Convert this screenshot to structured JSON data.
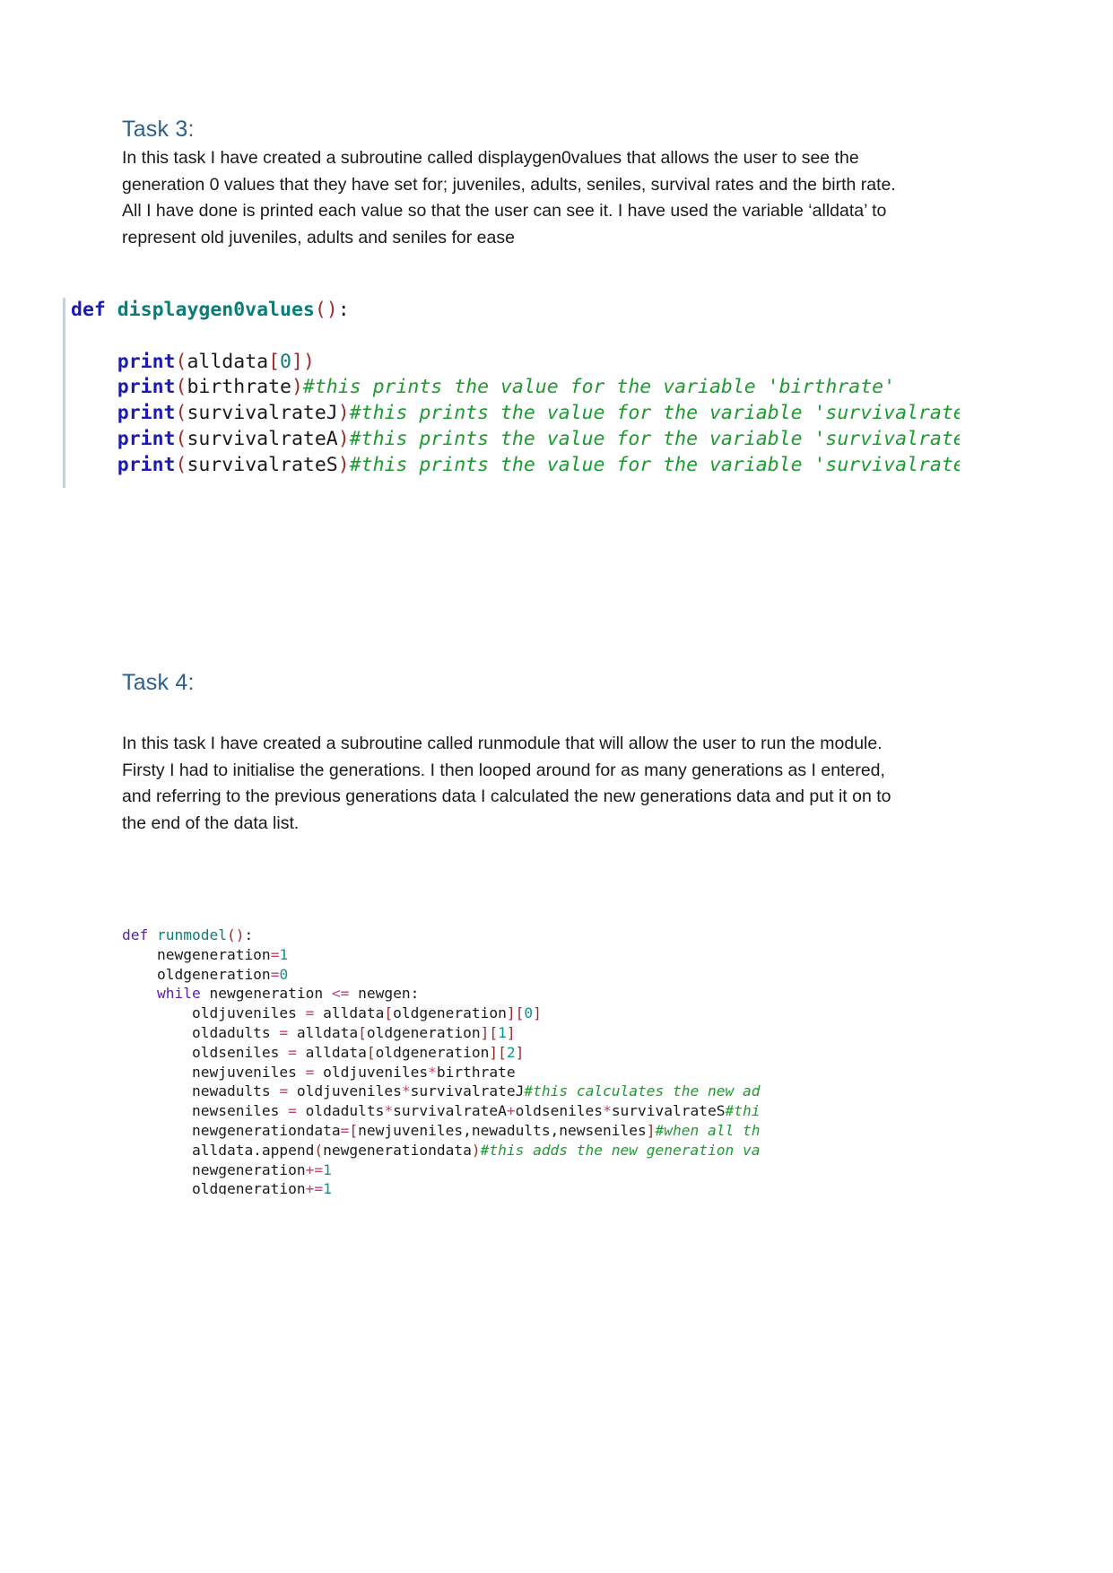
{
  "document": {
    "background": "#ffffff",
    "heading_color": "#2E6189",
    "body_color": "#1a1a1a"
  },
  "task3": {
    "heading": "Task 3:",
    "paragraph_lines": [
      "In this task I have created a subroutine called displaygen0values that allows the user to see the",
      "generation 0 values that they have set for; juveniles, adults, seniles, survival rates and the birth rate.",
      "All I have done is printed each value so that the user can see it. I have used the variable ‘alldata’ to",
      "represent old juveniles, adults and seniles for ease"
    ],
    "code": {
      "language": "python",
      "lines": [
        [
          {
            "text": "def ",
            "type": "keyword"
          },
          {
            "text": "displaygen0values",
            "type": "function-def"
          },
          {
            "text": "()",
            "type": "paren"
          },
          {
            "text": ":",
            "type": "plain"
          }
        ],
        [],
        [
          {
            "text": "    ",
            "type": "plain"
          },
          {
            "text": "print",
            "type": "builtin"
          },
          {
            "text": "(",
            "type": "paren"
          },
          {
            "text": "alldata",
            "type": "plain"
          },
          {
            "text": "[",
            "type": "bracket"
          },
          {
            "text": "0",
            "type": "number"
          },
          {
            "text": "]",
            "type": "bracket"
          },
          {
            "text": ")",
            "type": "paren"
          }
        ],
        [
          {
            "text": "    ",
            "type": "plain"
          },
          {
            "text": "print",
            "type": "builtin"
          },
          {
            "text": "(",
            "type": "paren"
          },
          {
            "text": "birthrate",
            "type": "plain"
          },
          {
            "text": ")",
            "type": "paren"
          },
          {
            "text": "#this prints the value for the variable 'birthrate'",
            "type": "comment"
          }
        ],
        [
          {
            "text": "    ",
            "type": "plain"
          },
          {
            "text": "print",
            "type": "builtin"
          },
          {
            "text": "(",
            "type": "paren"
          },
          {
            "text": "survivalrateJ",
            "type": "plain"
          },
          {
            "text": ")",
            "type": "paren"
          },
          {
            "text": "#this prints the value for the variable 'survivalrateJ'",
            "type": "comment"
          }
        ],
        [
          {
            "text": "    ",
            "type": "plain"
          },
          {
            "text": "print",
            "type": "builtin"
          },
          {
            "text": "(",
            "type": "paren"
          },
          {
            "text": "survivalrateA",
            "type": "plain"
          },
          {
            "text": ")",
            "type": "paren"
          },
          {
            "text": "#this prints the value for the variable 'survivalrateA'",
            "type": "comment"
          }
        ],
        [
          {
            "text": "    ",
            "type": "plain"
          },
          {
            "text": "print",
            "type": "builtin"
          },
          {
            "text": "(",
            "type": "paren"
          },
          {
            "text": "survivalrateS",
            "type": "plain"
          },
          {
            "text": ")",
            "type": "paren"
          },
          {
            "text": "#this prints the value for the variable 'survivalrateS'",
            "type": "comment"
          }
        ]
      ]
    }
  },
  "task4": {
    "heading": "Task 4:",
    "paragraph_lines": [
      "In this task I have created a subroutine called runmodule that will allow the user to run the module.",
      "Firsty I had to initialise the generations. I then looped around for as many generations as I entered,",
      "and referring to the previous generations data I calculated the new generations data and put it on to",
      "the end of the data list."
    ],
    "code": {
      "language": "python",
      "lines": [
        [
          {
            "text": "def ",
            "type": "keyword"
          },
          {
            "text": "runmodel",
            "type": "function-def"
          },
          {
            "text": "()",
            "type": "paren"
          },
          {
            "text": ":",
            "type": "plain"
          }
        ],
        [
          {
            "text": "    newgeneration",
            "type": "plain"
          },
          {
            "text": "=",
            "type": "operator"
          },
          {
            "text": "1",
            "type": "number"
          }
        ],
        [
          {
            "text": "    oldgeneration",
            "type": "plain"
          },
          {
            "text": "=",
            "type": "operator"
          },
          {
            "text": "0",
            "type": "number"
          }
        ],
        [
          {
            "text": "    ",
            "type": "plain"
          },
          {
            "text": "while ",
            "type": "keyword"
          },
          {
            "text": "newgeneration ",
            "type": "plain"
          },
          {
            "text": "<=",
            "type": "operator"
          },
          {
            "text": " newgen:",
            "type": "plain"
          }
        ],
        [
          {
            "text": "        oldjuveniles ",
            "type": "plain"
          },
          {
            "text": "=",
            "type": "operator"
          },
          {
            "text": " alldata",
            "type": "plain"
          },
          {
            "text": "[",
            "type": "bracket"
          },
          {
            "text": "oldgeneration",
            "type": "plain"
          },
          {
            "text": "]",
            "type": "bracket"
          },
          {
            "text": "[",
            "type": "bracket"
          },
          {
            "text": "0",
            "type": "number"
          },
          {
            "text": "]",
            "type": "bracket"
          }
        ],
        [
          {
            "text": "        oldadults ",
            "type": "plain"
          },
          {
            "text": "=",
            "type": "operator"
          },
          {
            "text": " alldata",
            "type": "plain"
          },
          {
            "text": "[",
            "type": "bracket"
          },
          {
            "text": "oldgeneration",
            "type": "plain"
          },
          {
            "text": "]",
            "type": "bracket"
          },
          {
            "text": "[",
            "type": "bracket"
          },
          {
            "text": "1",
            "type": "number"
          },
          {
            "text": "]",
            "type": "bracket"
          }
        ],
        [
          {
            "text": "        oldseniles ",
            "type": "plain"
          },
          {
            "text": "=",
            "type": "operator"
          },
          {
            "text": " alldata",
            "type": "plain"
          },
          {
            "text": "[",
            "type": "bracket"
          },
          {
            "text": "oldgeneration",
            "type": "plain"
          },
          {
            "text": "]",
            "type": "bracket"
          },
          {
            "text": "[",
            "type": "bracket"
          },
          {
            "text": "2",
            "type": "number"
          },
          {
            "text": "]",
            "type": "bracket"
          }
        ],
        [
          {
            "text": "        newjuveniles ",
            "type": "plain"
          },
          {
            "text": "=",
            "type": "operator"
          },
          {
            "text": " oldjuveniles",
            "type": "plain"
          },
          {
            "text": "*",
            "type": "operator"
          },
          {
            "text": "birthrate",
            "type": "plain"
          }
        ],
        [
          {
            "text": "        newadults ",
            "type": "plain"
          },
          {
            "text": "=",
            "type": "operator"
          },
          {
            "text": " oldjuveniles",
            "type": "plain"
          },
          {
            "text": "*",
            "type": "operator"
          },
          {
            "text": "survivalrateJ",
            "type": "plain"
          },
          {
            "text": "#this calculates the new ad",
            "type": "comment"
          }
        ],
        [
          {
            "text": "        newseniles ",
            "type": "plain"
          },
          {
            "text": "=",
            "type": "operator"
          },
          {
            "text": " oldadults",
            "type": "plain"
          },
          {
            "text": "*",
            "type": "operator"
          },
          {
            "text": "survivalrateA",
            "type": "plain"
          },
          {
            "text": "+",
            "type": "operator"
          },
          {
            "text": "oldseniles",
            "type": "plain"
          },
          {
            "text": "*",
            "type": "operator"
          },
          {
            "text": "survivalrateS",
            "type": "plain"
          },
          {
            "text": "#thi",
            "type": "comment"
          }
        ],
        [
          {
            "text": "        newgenerationdata",
            "type": "plain"
          },
          {
            "text": "=",
            "type": "operator"
          },
          {
            "text": "[",
            "type": "bracket"
          },
          {
            "text": "newjuveniles,newadults,newseniles",
            "type": "plain"
          },
          {
            "text": "]",
            "type": "bracket"
          },
          {
            "text": "#when all th",
            "type": "comment"
          }
        ],
        [
          {
            "text": "        alldata.append",
            "type": "plain"
          },
          {
            "text": "(",
            "type": "paren"
          },
          {
            "text": "newgenerationdata",
            "type": "plain"
          },
          {
            "text": ")",
            "type": "paren"
          },
          {
            "text": "#this adds the new generation va",
            "type": "comment"
          }
        ],
        [
          {
            "text": "        newgeneration",
            "type": "plain"
          },
          {
            "text": "+=",
            "type": "operator"
          },
          {
            "text": "1",
            "type": "number"
          }
        ],
        [
          {
            "text": "        oldgeneration",
            "type": "plain"
          },
          {
            "text": "+=",
            "type": "operator"
          },
          {
            "text": "1",
            "type": "number"
          }
        ]
      ]
    }
  }
}
